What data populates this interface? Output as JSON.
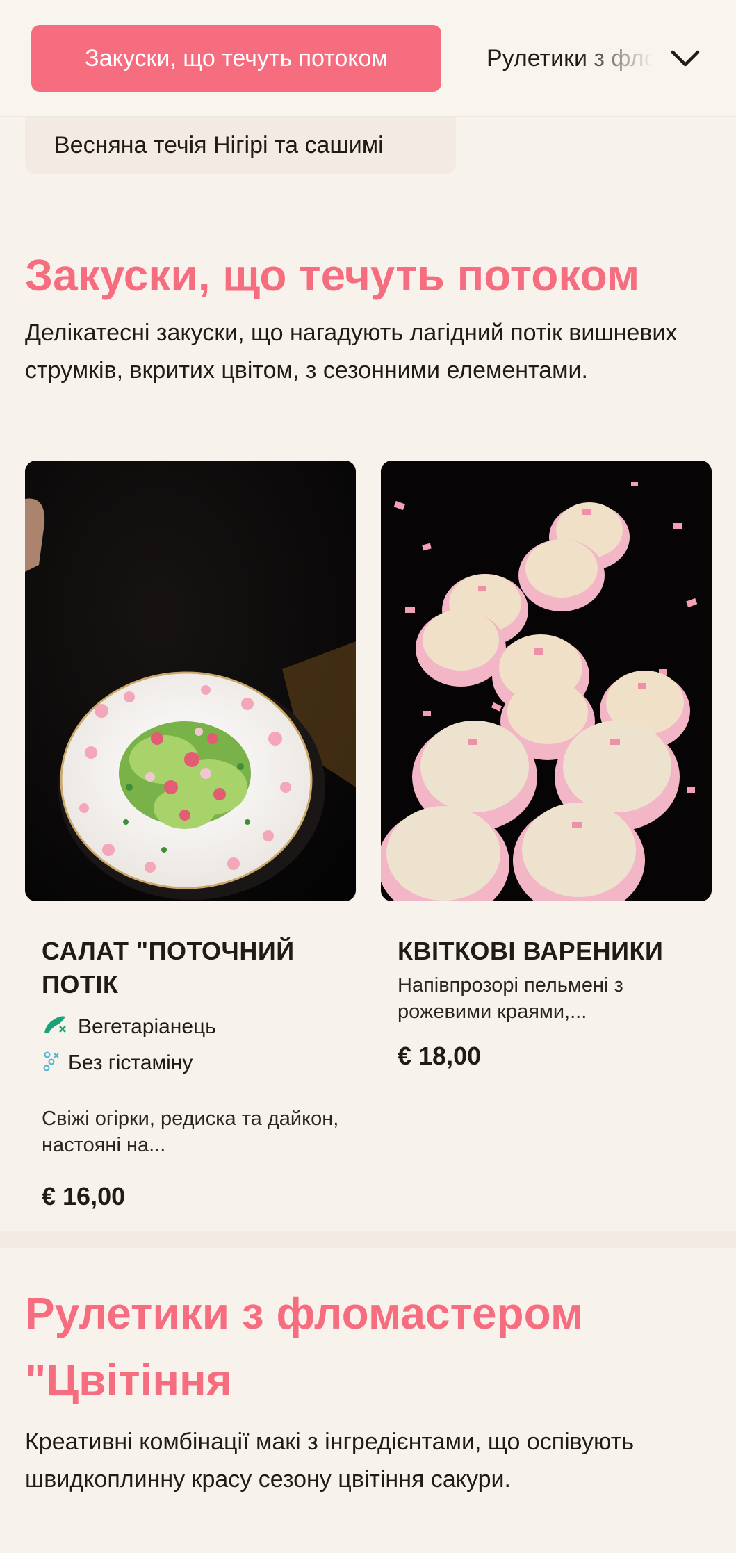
{
  "nav": {
    "active_category": "Закуски, що течуть потоком",
    "next_category": "Рулетики з фломастером",
    "sub_category": "Весняна течія Нігірі та сашимі"
  },
  "section1": {
    "title": "Закуски, що течуть потоком",
    "description": "Делікатесні закуски, що нагадують лагідний потік вишневих струмків, вкритих цвітом, з сезонними елементами."
  },
  "items": [
    {
      "name": "Салат \"Поточний потік",
      "tags": [
        "Вегетаріанець",
        "Без гістаміну"
      ],
      "description": "Свіжі огірки, редиска та дайкон, настояні на...",
      "price": "€ 16,00"
    },
    {
      "name": "Квіткові вареники",
      "description": "Напівпрозорі пельмені з рожевими краями,...",
      "price": "€ 18,00"
    }
  ],
  "section2": {
    "title": "Рулетики з фломастером \"Цвітіння",
    "description": "Креативні комбінації макі з інгредієнтами, що оспівують швидкоплинну красу сезону цвітіння сакури."
  },
  "colors": {
    "accent": "#f76d80",
    "background": "#f7f3ec",
    "vegetarian_icon": "#1aa37a",
    "histamine_icon": "#4fb5d6"
  }
}
